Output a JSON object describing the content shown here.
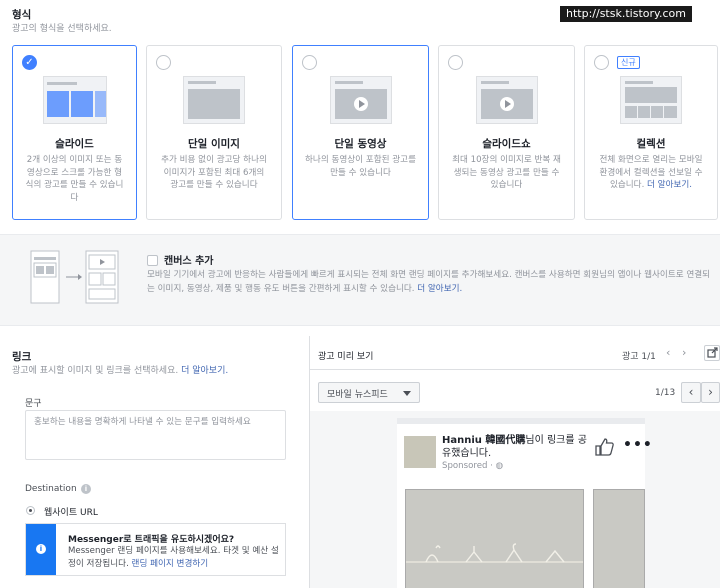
{
  "watermark": "http://stsk.tistory.com",
  "format": {
    "title": "형식",
    "subtitle": "광고의 형식을 선택하세요.",
    "options": [
      {
        "label": "슬라이드",
        "desc": "2개 이상의 이미지 또는 동영상으로 스크롤 가능한 형식의 광고를 만들 수 있습니다",
        "selected": true
      },
      {
        "label": "단일 이미지",
        "desc": "추가 비용 없이 광고당 하나의 이미지가 포함된 최대 6개의 광고를 만들 수 있습니다",
        "selected": false
      },
      {
        "label": "단일 동영상",
        "desc": "하나의 동영상이 포함된 광고를 만들 수 있습니다",
        "selected": false
      },
      {
        "label": "슬라이드쇼",
        "desc": "최대 10장의 이미지로 반복 재생되는 동영상 광고를 만들 수 있습니다",
        "selected": false
      },
      {
        "label": "컬렉션",
        "desc": "전체 화면으로 열리는 모바일 환경에서 컬렉션을 선보일 수 있습니다.",
        "link": "더 알아보기.",
        "badge": "신규",
        "selected": false
      }
    ]
  },
  "canvas": {
    "title": "캔버스 추가",
    "desc": "모바일 기기에서 광고에 반응하는 사람들에게 빠르게 표시되는 전체 화면 랜딩 페이지를 추가해보세요. 캔버스를 사용하면 회원님의 앱이나 웹사이트로 연결되는 이미지, 동영상, 제품 및 행동 유도 버튼을 간편하게 표시할 수 있습니다.",
    "link": "더 알아보기."
  },
  "link_section": {
    "title": "링크",
    "subtitle": "광고에 표시할 이미지 및 링크를 선택하세요.",
    "subtitle_link": "더 알아보기.",
    "text_label": "문구",
    "text_placeholder": "홍보하는 내용을 명확하게 나타낼 수 있는 문구를 입력하세요",
    "destination_label": "Destination",
    "destination_option": "웹사이트 URL",
    "messenger_title": "Messenger로 트래픽을 유도하시겠어요?",
    "messenger_desc": "Messenger 랜딩 페이지를 사용해보세요. 타겟 및 예산 설정이 저장됩니다.",
    "messenger_link": "랜딩 페이지 변경하기"
  },
  "preview": {
    "title": "광고 미리 보기",
    "ad_counter": "광고 1/1",
    "placement": "모바일 뉴스피드",
    "placement_counter": "1/13",
    "page_name": "Hanniu 韓國代購",
    "post_text_tail": "님이 링크를 공유했습니다.",
    "sponsored": "Sponsored"
  },
  "colors": {
    "accent": "#4080ff",
    "link": "#4267b2",
    "info": "#1877f2"
  }
}
